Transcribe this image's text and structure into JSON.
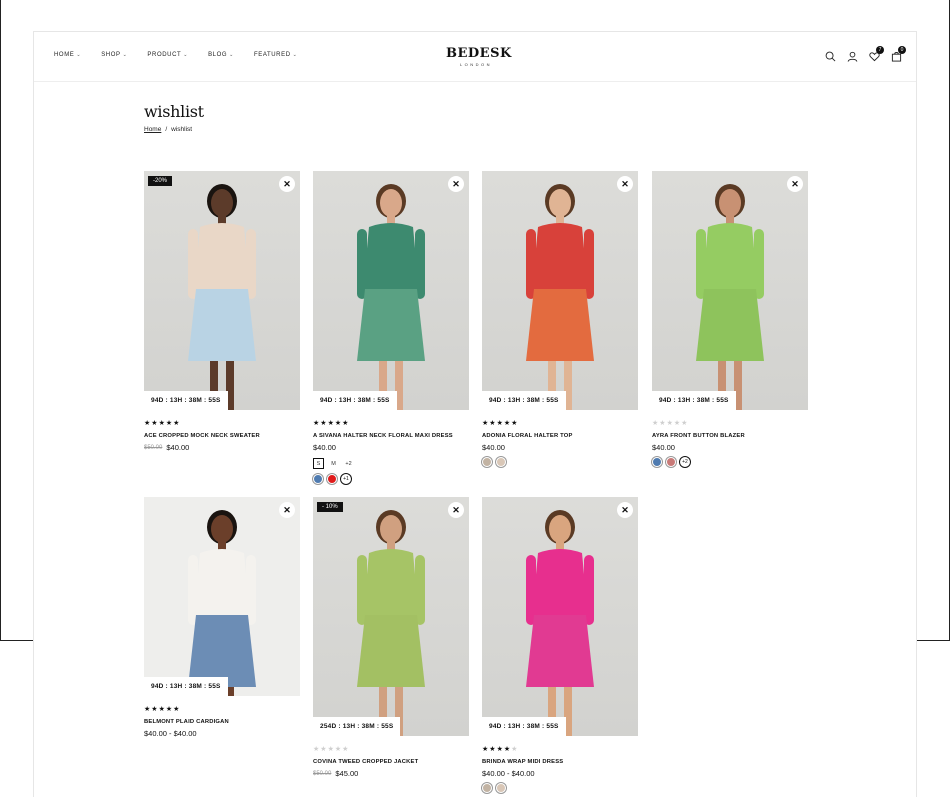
{
  "nav": {
    "items": [
      {
        "label": "HOME"
      },
      {
        "label": "SHOP"
      },
      {
        "label": "PRODUCT"
      },
      {
        "label": "BLOG"
      },
      {
        "label": "FEATURED"
      }
    ]
  },
  "logo": {
    "main": "BEDESK",
    "sub": "LONDON"
  },
  "header_icons": {
    "search": "search-icon",
    "account": "user-icon",
    "wishlist": "heart-icon",
    "cart": "bag-icon",
    "wishlist_count": "7",
    "cart_count": "0"
  },
  "page": {
    "title": "wishlist",
    "breadcrumb_home": "Home",
    "breadcrumb_sep": "/",
    "breadcrumb_current": "wishlist"
  },
  "products": [
    {
      "name": "ACE CROPPED MOCK NECK SWEATER",
      "old_price": "$50.00",
      "price": "$40.00",
      "discount": "-20%",
      "countdown": "94D : 13H : 38M : 55S",
      "stars": 5,
      "top_color": "#e9d7c7",
      "bottom_color": "#b9d3e4",
      "skin": "#5c3b2a"
    },
    {
      "name": "A SIVANA HALTER NECK FLORAL MAXI DRESS",
      "old_price": "",
      "price": "$40.00",
      "discount": "",
      "countdown": "94D : 13H : 38M : 55S",
      "stars": 5,
      "sizes": [
        "S",
        "M",
        "+2"
      ],
      "swatches": [
        "#4f7bb0",
        "#e01b1b"
      ],
      "more": "+1",
      "top_color": "#3d8a6f",
      "bottom_color": "#5aa183",
      "skin": "#d9a88a"
    },
    {
      "name": "ADONIA FLORAL HALTER TOP",
      "old_price": "",
      "price": "$40.00",
      "discount": "",
      "countdown": "94D : 13H : 38M : 55S",
      "stars": 5,
      "swatches": [
        "#c2b3a3",
        "#d9c7b7"
      ],
      "top_color": "#d8413a",
      "bottom_color": "#e36b3f",
      "skin": "#e0b494"
    },
    {
      "name": "AYRA FRONT BUTTON BLAZER",
      "old_price": "",
      "price": "$40.00",
      "discount": "",
      "countdown": "94D : 13H : 38M : 55S",
      "stars": 0,
      "swatches": [
        "#4f7bb0",
        "#c97a78"
      ],
      "more": "+2",
      "top_color": "#95cc62",
      "bottom_color": "#8ec35c",
      "skin": "#c89173"
    },
    {
      "name": "BELMONT PLAID CARDIGAN",
      "old_price": "",
      "price": "$40.00 - $40.00",
      "discount": "",
      "countdown": "94D : 13H : 38M : 55S",
      "stars": 5,
      "top_color": "#f4f2ee",
      "bottom_color": "#6c8db5",
      "skin": "#6b3f2a"
    },
    {
      "name": "COVINA TWEED CROPPED JACKET",
      "old_price": "$50.00",
      "price": "$45.00",
      "discount": "- 10%",
      "countdown": "254D : 13H : 38M : 55S",
      "stars": 0,
      "top_color": "#a6c466",
      "bottom_color": "#a3c063",
      "skin": "#d0a080"
    },
    {
      "name": "BRINDA WRAP MIDI DRESS",
      "old_price": "",
      "price": "$40.00 - $40.00",
      "discount": "",
      "countdown": "94D : 13H : 38M : 55S",
      "stars": 4,
      "swatches": [
        "#c2b3a3",
        "#d9c7b7"
      ],
      "top_color": "#e72f8e",
      "bottom_color": "#e13a92",
      "skin": "#d9a57f"
    }
  ]
}
